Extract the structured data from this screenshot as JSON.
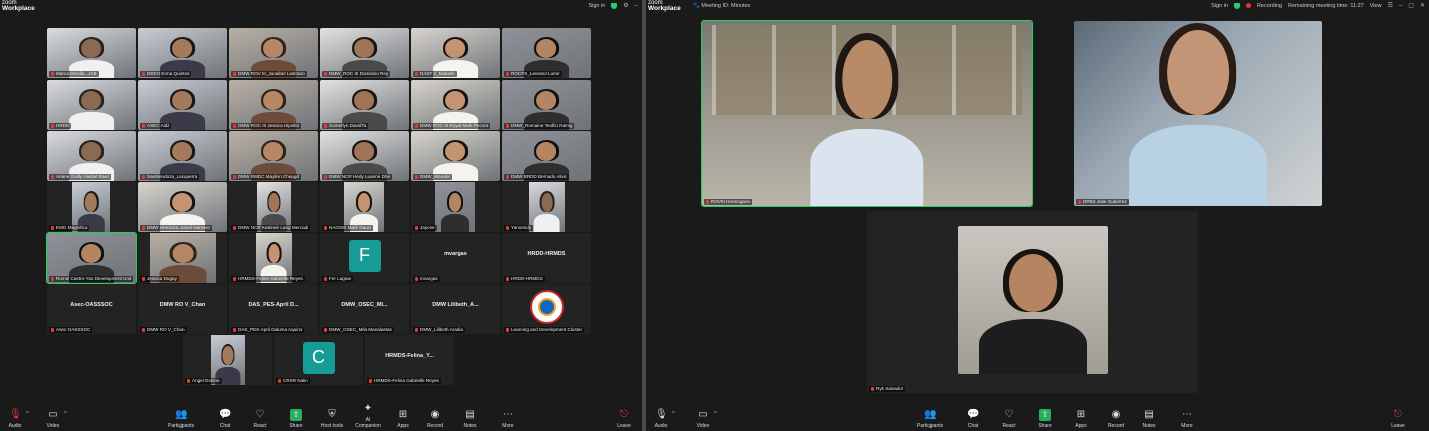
{
  "left": {
    "app_logo_line1": "zoom",
    "app_logo_line2": "Workplace",
    "signin": "Sign in",
    "tiles": [
      "Marca Movilla...JAB",
      "DEEO Erma Quintos",
      "DMW ROV III_Junaibel Lastrano",
      "DMW_ROC III Dumisino Rey",
      "DASF 2_Mabelle",
      "ROCPS_Leonard Lumir",
      "HRDD",
      "ASEC Aidz",
      "DMW ROC III Jessica Hipolito",
      "Somerlyn DavidTa",
      "DMW ROC III Royal Mark Pecora",
      "DMW_Romaine Teofilo Ramig",
      "Ariane Gailly Hastiel Raez",
      "SaoMendoza_Lacquerra",
      "DMW RMDC Maylinn Chepgd",
      "DMW NCR Hedy Luanne Dhe",
      "DMW_Wendel",
      "DMW BRDD Bernado Alivic"
    ],
    "row4": [
      "EMG Magnifico",
      "DMW Hermoza Jomel Narvaez",
      "DMW NCR Katrineir Lang Mercadi",
      "NAOSSI Mark Gauci",
      "Jaycee",
      "Yanomidy"
    ],
    "row5": [
      "Romel Castro-Yao Development Unit",
      "Jessica Dugay",
      "HRMDS-Feline Gabrielle Reyes"
    ],
    "f_letter": "F",
    "f_name": "Fer Lagsar",
    "mvargas_card": "mvargas",
    "mvargas_name": "mvargas",
    "hrdd_card": "HRDD-HRMDS",
    "hrdd_name": "HRDD-HRMDS",
    "row6_cards": [
      "Asec-OASSSOC",
      "DMW RO V_Chan",
      "DAS_PES-April D...",
      "DMW_OSEC_MI...",
      "DMW Lilibeth_A..."
    ],
    "row6_names": [
      "Asec-OASSSOC",
      "DMW RO V_Chan",
      "DAS_PES-April Daluma Aquino",
      "DMW_OSEC_Mila Manalastas",
      "DMW_Lilibeth Aradia"
    ],
    "seal_name": "Learning and Development Cluster",
    "row7": {
      "photo_name": "Angel Dolorie",
      "c_letter": "C",
      "c_name": "CRSR Nalin",
      "text_card": "HRMDS-Felina_Y...",
      "text_name": "HRMDS-Felina Gabrielle Reyes"
    },
    "toolbar": [
      {
        "label": "Audio",
        "icon": "mic-muted-icon"
      },
      {
        "label": "Video",
        "icon": "video-icon"
      },
      {
        "label": "Participants",
        "icon": "participants-icon",
        "count": "41"
      },
      {
        "label": "Chat",
        "icon": "chat-icon"
      },
      {
        "label": "React",
        "icon": "heart-icon"
      },
      {
        "label": "Share",
        "icon": "share-icon"
      },
      {
        "label": "Host tools",
        "icon": "shield-icon"
      },
      {
        "label": "AI Companion",
        "icon": "sparkle-icon"
      },
      {
        "label": "Apps",
        "icon": "apps-icon"
      },
      {
        "label": "Record",
        "icon": "record-icon"
      },
      {
        "label": "Notes",
        "icon": "notes-icon"
      },
      {
        "label": "More",
        "icon": "more-icon"
      },
      {
        "label": "Leave",
        "icon": "leave-icon"
      }
    ]
  },
  "right": {
    "app_logo_line1": "zoom",
    "app_logo_line2": "Workplace",
    "meeting_info": "Meeting ID: Minutes",
    "signin": "Sign in",
    "recording": "Recording",
    "remaining": "Remaining meeting time: 11:27",
    "view": "View",
    "tiles": [
      "ROVIII Hermogane",
      "DPBS Jose Gutierrez",
      "Ryk Salvador"
    ],
    "toolbar": [
      {
        "label": "Audio",
        "icon": "mic-icon"
      },
      {
        "label": "Video",
        "icon": "video-icon"
      },
      {
        "label": "Participants",
        "icon": "participants-icon",
        "count": "3"
      },
      {
        "label": "Chat",
        "icon": "chat-icon"
      },
      {
        "label": "React",
        "icon": "heart-icon"
      },
      {
        "label": "Share",
        "icon": "share-icon"
      },
      {
        "label": "Apps",
        "icon": "apps-icon"
      },
      {
        "label": "Record",
        "icon": "record-icon"
      },
      {
        "label": "Notes",
        "icon": "notes-icon"
      },
      {
        "label": "More",
        "icon": "more-icon"
      },
      {
        "label": "Leave",
        "icon": "leave-icon"
      }
    ]
  },
  "colors": {
    "accent_green": "#27ae60",
    "leave_red": "#e53935",
    "active_border": "#23d160",
    "avatar_teal": "#179b96"
  }
}
